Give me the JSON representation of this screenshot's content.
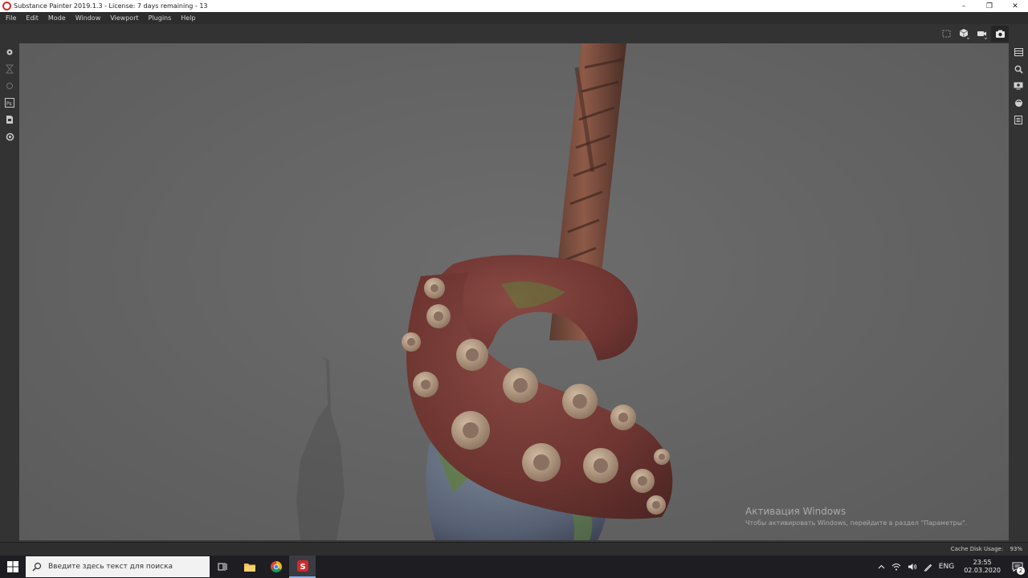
{
  "window": {
    "title": "Substance Painter 2019.1.3 - License: 7 days remaining - 13",
    "controls": {
      "minimize": "–",
      "restore": "❐",
      "close": "✕"
    }
  },
  "menu": [
    "File",
    "Edit",
    "Mode",
    "Window",
    "Viewport",
    "Plugins",
    "Help"
  ],
  "viewport_tools": [
    {
      "icon": "selection-icon",
      "active": false
    },
    {
      "icon": "cube-view-icon",
      "active": false
    },
    {
      "icon": "camera-video-icon",
      "active": false
    },
    {
      "icon": "screenshot-camera-icon",
      "active": true
    }
  ],
  "left_tools": [
    "paint-brush-icon",
    "hourglass-icon",
    "eraser-icon",
    "photoshop-export-icon",
    "export-textures-icon",
    "settings-gear-icon"
  ],
  "right_tools": [
    "layers-panel-icon",
    "zoom-inspect-icon",
    "display-settings-icon",
    "shader-settings-icon",
    "texture-set-icon"
  ],
  "activation": {
    "title": "Активация Windows",
    "subtitle": "Чтобы активировать Windows, перейдите в раздел \"Параметры\"."
  },
  "status": {
    "cache_label": "Cache Disk Usage:",
    "cache_value": "93%"
  },
  "taskbar": {
    "search_placeholder": "Введите здесь текст для поиска",
    "apps": [
      "task-view-icon",
      "file-explorer-icon",
      "chrome-icon",
      "substance-painter-icon"
    ],
    "language": "ENG",
    "time": "23:55",
    "date": "02.03.2020",
    "notification_count": "2"
  },
  "colors": {
    "accent_red": "#d42a2a",
    "viewport_bg": "#636363",
    "tentacle": "#7a3a36",
    "sucker": "#b9a089",
    "moss": "#5f7d3a"
  }
}
